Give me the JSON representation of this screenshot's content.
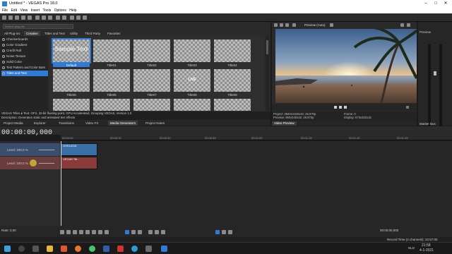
{
  "app": {
    "title": "Untitled * - VEGAS Pro 18.0"
  },
  "menu": [
    "File",
    "Edit",
    "View",
    "Insert",
    "Tools",
    "Options",
    "Help"
  ],
  "plugins": {
    "search_placeholder": "Search plug-ins",
    "tabs": [
      "All Plug-ins",
      "Creative",
      "Titles and Text",
      "Utility",
      "Third Party",
      "Favorites"
    ],
    "tree": [
      "Checkerboards",
      "Color Gradient",
      "Credit Roll",
      "Noise Texture",
      "Solid Color",
      "Test Pattern and Color Bars",
      "Titles and Text"
    ],
    "selected_tree": "Titles and Text",
    "presets": [
      {
        "label": "Default",
        "text": "Sample Text"
      },
      {
        "label": "Title01",
        "text": ""
      },
      {
        "label": "Title02",
        "text": ""
      },
      {
        "label": "Title03",
        "text": ""
      },
      {
        "label": "Title04",
        "text": ""
      },
      {
        "label": "Title05",
        "text": ""
      },
      {
        "label": "Title06",
        "text": ""
      },
      {
        "label": "Title07",
        "text": ""
      },
      {
        "label": "Title08",
        "text": "LIVE"
      },
      {
        "label": "Title09",
        "text": ""
      }
    ],
    "desc_line1": "VEGAS Titles & Text: OFX, 32-bit floating point, GPU Accelerated, Grouping VEGAS, Version 1.0",
    "desc_line2": "Description: Generates static and animated text effects"
  },
  "window_tabs": [
    "Project Media",
    "Explorer",
    "Transitions",
    "Video FX",
    "Media Generators",
    "Project Notes"
  ],
  "preview": {
    "mode": "Preview (Auto)",
    "project": "Project:   3840x2160x32; 29,970p",
    "preview": "Preview:   960x540x32; 29,970p",
    "frame": "Frame:        0",
    "display": "Display:     573x322x32",
    "tab": "Video Preview"
  },
  "master": {
    "title": "Preview",
    "tab": "Master Bus",
    "scale": [
      "3",
      "6",
      "9",
      "12",
      "15",
      "18",
      "21",
      "24",
      "27",
      "30",
      "33",
      "36",
      "39",
      "42",
      "45",
      "48",
      "51",
      "54",
      "57"
    ]
  },
  "timeline": {
    "timecode": "00:00:00,000",
    "ruler": [
      "00:00:00",
      "00:00:15",
      "00:00:30",
      "00:00:45",
      "00:01:00",
      "00:01:15",
      "00:01:30",
      "00:01:45"
    ],
    "tracks": [
      {
        "level": "Level: 100,0 %",
        "clips": [
          {
            "name": "GH014218"
          }
        ]
      },
      {
        "level": "Level: 100,0 %",
        "clips": [
          {
            "name": "VEGAS Titl..."
          }
        ]
      }
    ],
    "rate": "Rate: 0,00",
    "end_time": "00:00:00,000",
    "record_time": "Record Time (2 channels): 22:57:00"
  },
  "taskbar": {
    "time": "21:58",
    "date": "4-1-2021",
    "lang": "NLD"
  },
  "colors": {
    "accent": "#2f7bd6",
    "video_clip": "#3a6fa8",
    "title_clip": "#8b3a3a"
  }
}
